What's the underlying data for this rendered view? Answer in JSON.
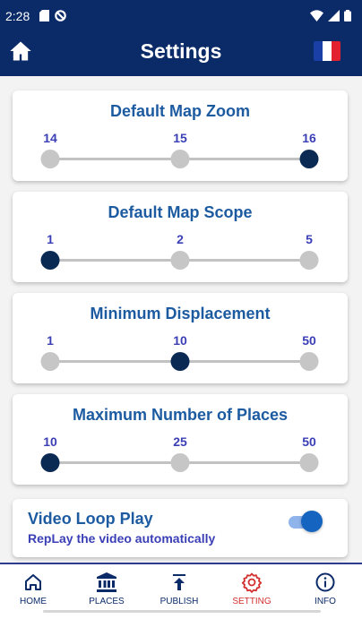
{
  "status_bar": {
    "time": "2:28"
  },
  "app_bar": {
    "title": "Settings"
  },
  "colors": {
    "primary": "#0a2a68",
    "accent_text": "#1d5ba1",
    "value_text": "#3b3fb6",
    "active_nav": "#d32f2f"
  },
  "settings": [
    {
      "title": "Default Map Zoom",
      "options": [
        "14",
        "15",
        "16"
      ],
      "selected_index": 2
    },
    {
      "title": "Default Map Scope",
      "options": [
        "1",
        "2",
        "5"
      ],
      "selected_index": 0
    },
    {
      "title": "Minimum Displacement",
      "options": [
        "1",
        "10",
        "50"
      ],
      "selected_index": 1
    },
    {
      "title": "Maximum Number of Places",
      "options": [
        "10",
        "25",
        "50"
      ],
      "selected_index": 0
    }
  ],
  "video_loop": {
    "title": "Video Loop Play",
    "subtitle": "RepLay the video automatically",
    "enabled": true
  },
  "nav": [
    {
      "label": "HOME",
      "icon": "home-icon",
      "active": false
    },
    {
      "label": "PLACES",
      "icon": "bank-icon",
      "active": false
    },
    {
      "label": "PUBLISH",
      "icon": "publish-icon",
      "active": false
    },
    {
      "label": "SETTING",
      "icon": "gear-icon",
      "active": true
    },
    {
      "label": "INFO",
      "icon": "info-icon",
      "active": false
    }
  ]
}
